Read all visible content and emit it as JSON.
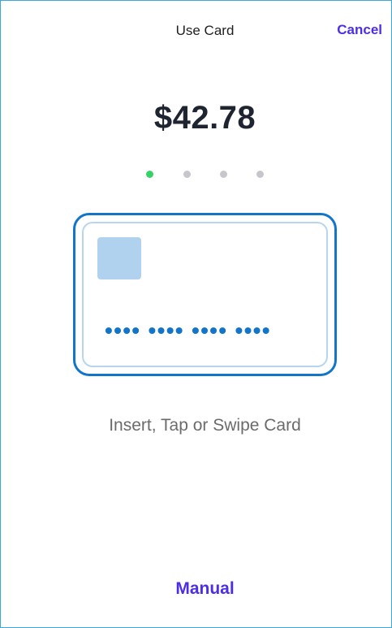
{
  "header": {
    "title": "Use Card",
    "cancel_label": "Cancel"
  },
  "payment": {
    "amount": "$42.78"
  },
  "progress": {
    "total_steps": 4,
    "current_step": 1
  },
  "card": {
    "number_mask": "•••• •••• •••• ••••"
  },
  "instruction": "Insert, Tap or Swipe Card",
  "footer": {
    "manual_label": "Manual"
  },
  "colors": {
    "accent": "#4a2fe6",
    "card_blue": "#1275c9",
    "card_light": "#b6d6f0",
    "chip": "#b1d2ee",
    "dot_active": "#37d267",
    "dot_inactive": "#c5c7cc"
  }
}
